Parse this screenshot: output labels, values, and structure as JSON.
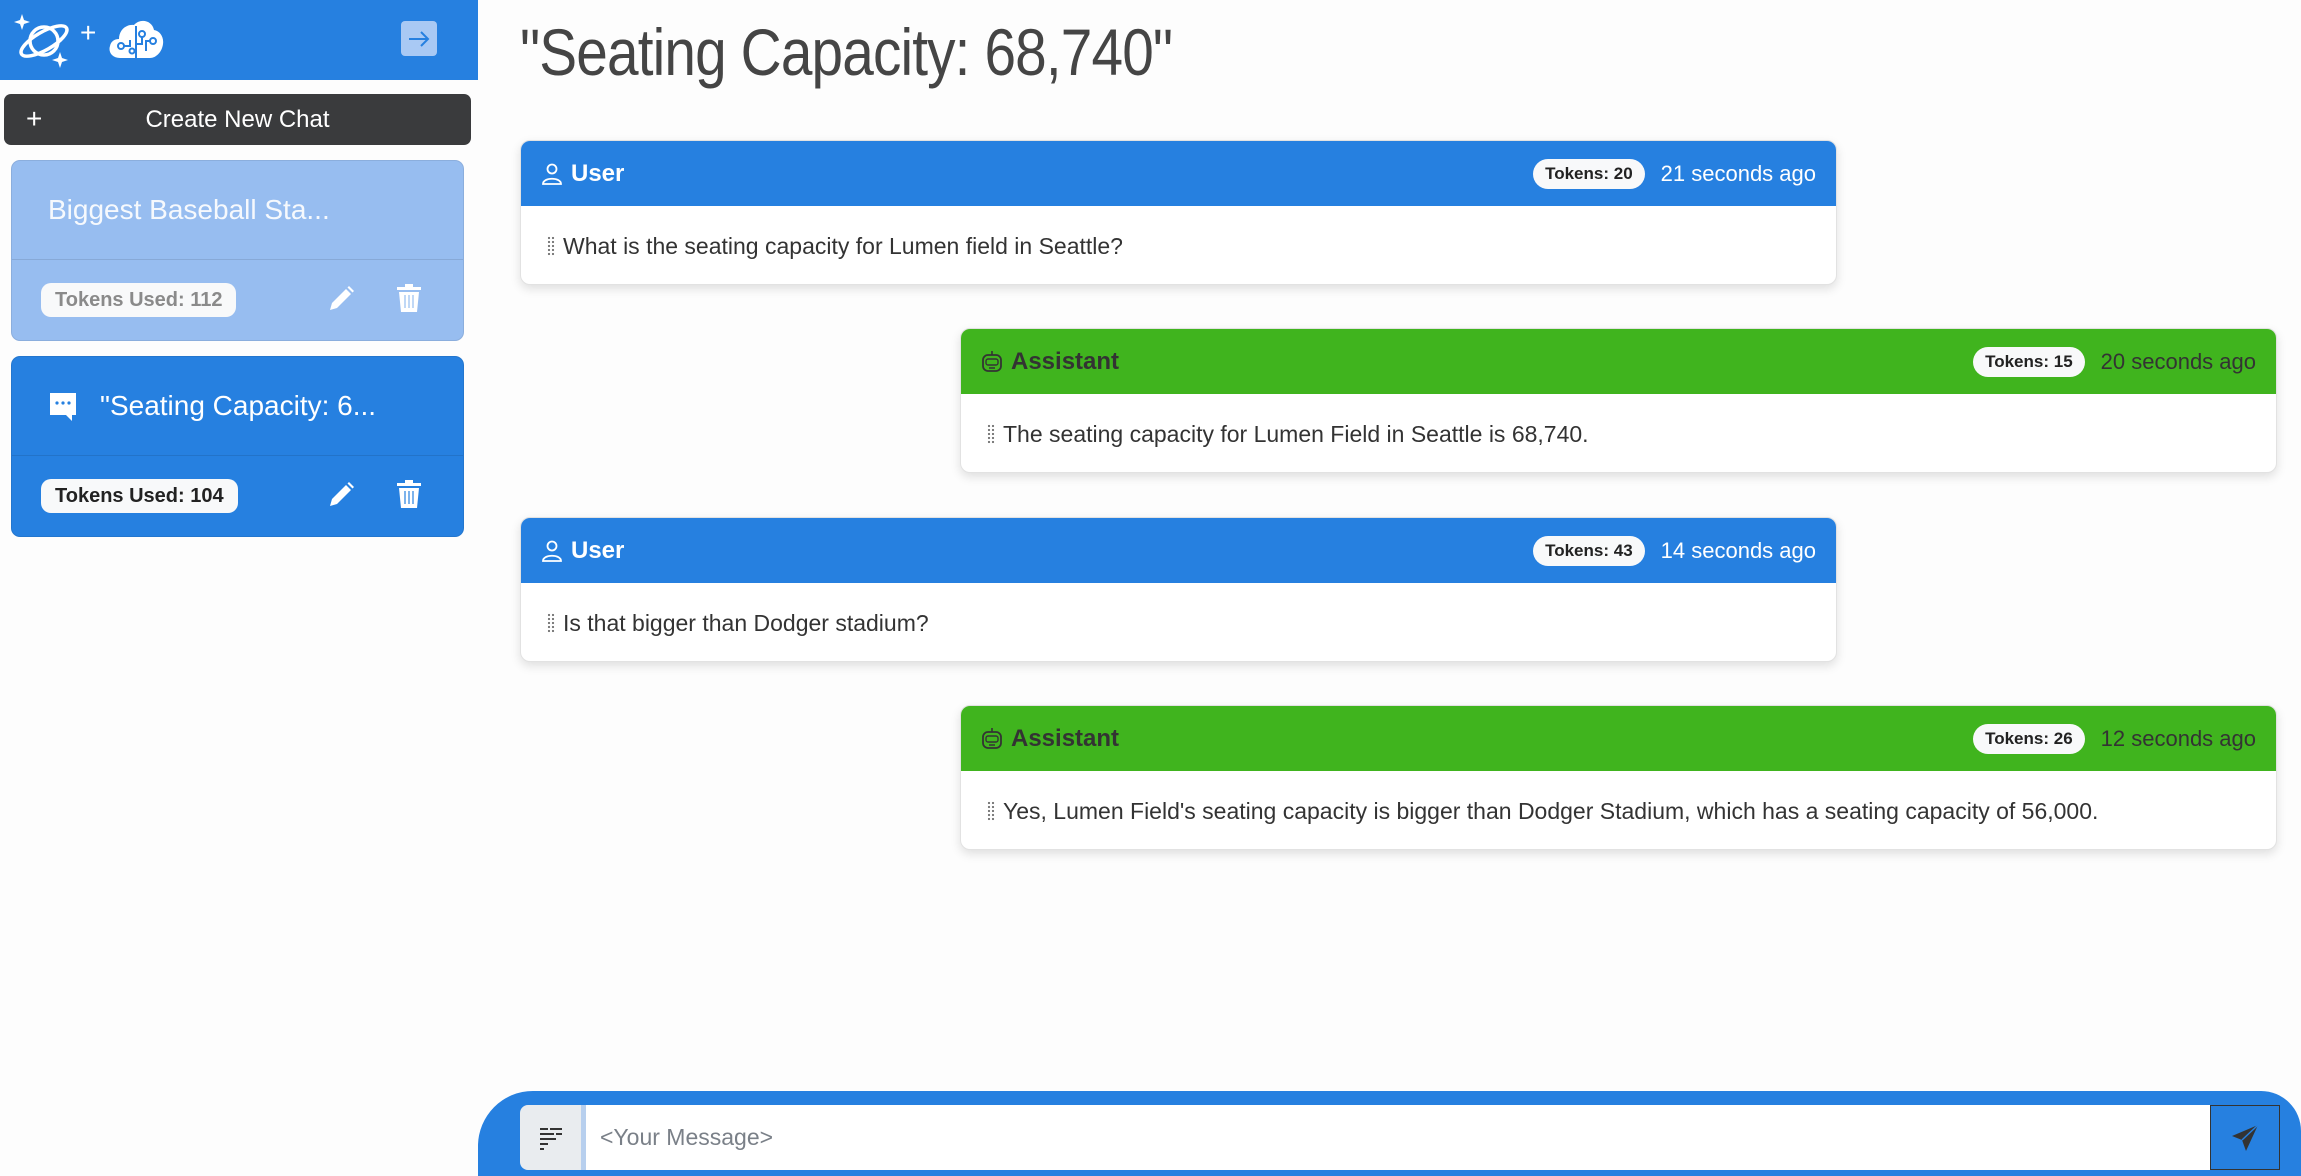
{
  "sidebar": {
    "logo_plus": "+",
    "new_chat": {
      "icon": "+",
      "label": "Create New Chat"
    },
    "chats": [
      {
        "title": "Biggest Baseball Sta...",
        "tokens_label": "Tokens Used: 112",
        "active": false
      },
      {
        "title": "\"Seating Capacity: 6...",
        "tokens_label": "Tokens Used: 104",
        "active": true
      }
    ]
  },
  "main": {
    "title": "\"Seating Capacity: 68,740\"",
    "messages": [
      {
        "role": "User",
        "tokens": "Tokens: 20",
        "time": "21 seconds ago",
        "text": "What is the seating capacity for Lumen field in Seattle?"
      },
      {
        "role": "Assistant",
        "tokens": "Tokens: 15",
        "time": "20 seconds ago",
        "text": "The seating capacity for Lumen Field in Seattle is 68,740."
      },
      {
        "role": "User",
        "tokens": "Tokens: 43",
        "time": "14 seconds ago",
        "text": "Is that bigger than Dodger stadium?"
      },
      {
        "role": "Assistant",
        "tokens": "Tokens: 26",
        "time": "12 seconds ago",
        "text": "Yes, Lumen Field's seating capacity is bigger than Dodger Stadium, which has a seating capacity of 56,000."
      }
    ]
  },
  "composer": {
    "placeholder": "<Your Message>",
    "value": ""
  },
  "colors": {
    "primary": "#2680e0",
    "assistant": "#40b41e",
    "dark_button": "#3a3b3d",
    "inactive_chat": "#97bdf0"
  }
}
